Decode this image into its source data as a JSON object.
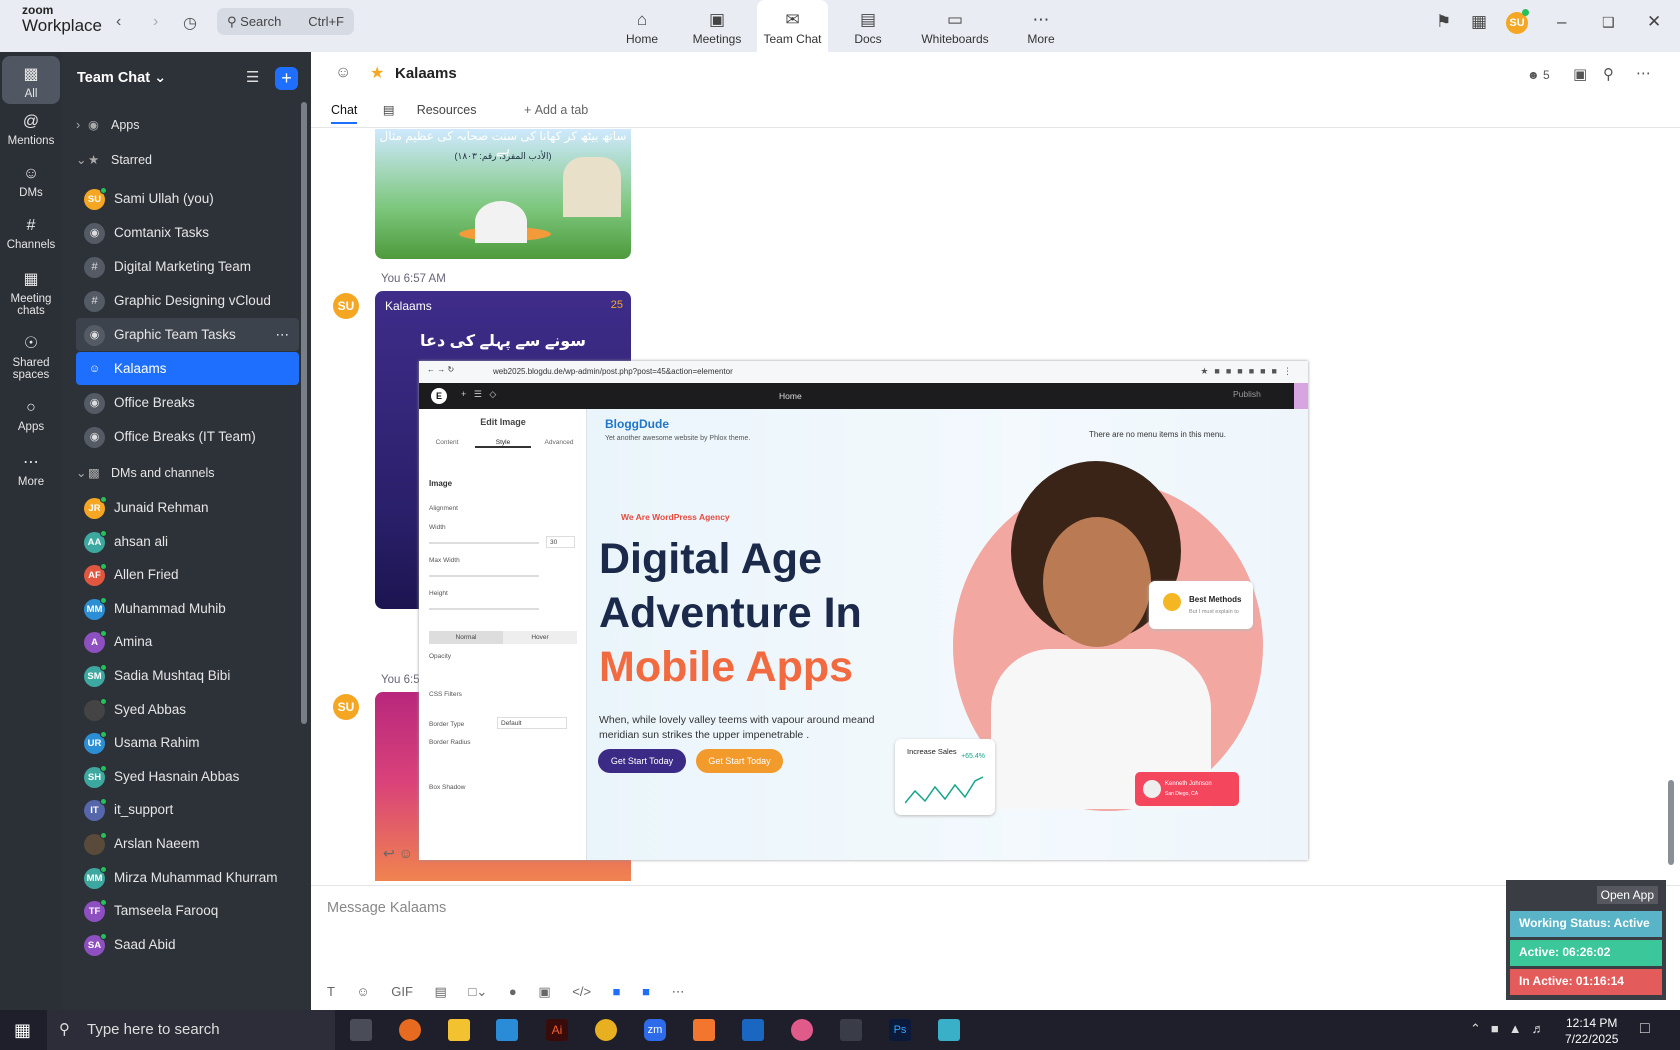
{
  "brand": {
    "line1": "zoom",
    "line2": "Workplace"
  },
  "search": {
    "label": "Search",
    "shortcut": "Ctrl+F"
  },
  "tabs": [
    {
      "label": "Home",
      "icon": "home-icon"
    },
    {
      "label": "Meetings",
      "icon": "video-icon"
    },
    {
      "label": "Team Chat",
      "icon": "chat-icon"
    },
    {
      "label": "Docs",
      "icon": "doc-icon"
    },
    {
      "label": "Whiteboards",
      "icon": "whiteboard-icon"
    },
    {
      "label": "More",
      "icon": "more-icon"
    }
  ],
  "user": {
    "initials": "SU"
  },
  "rail": [
    {
      "label": "All"
    },
    {
      "label": "Mentions"
    },
    {
      "label": "DMs"
    },
    {
      "label": "Channels"
    },
    {
      "label": "Meeting chats"
    },
    {
      "label": "Shared spaces"
    },
    {
      "label": "Apps"
    },
    {
      "label": "More"
    }
  ],
  "sidebar": {
    "title": "Team Chat",
    "apps": "Apps",
    "starred": "Starred",
    "dms": "DMs and channels",
    "starred_items": [
      {
        "label": "Sami Ullah (you)",
        "initials": "SU",
        "color": "#f5a623"
      },
      {
        "label": "Comtanix Tasks"
      },
      {
        "label": "Digital Marketing Team"
      },
      {
        "label": "Graphic Designing vCloud"
      },
      {
        "label": "Graphic Team Tasks"
      },
      {
        "label": "Kalaams"
      },
      {
        "label": "Office Breaks"
      },
      {
        "label": "Office Breaks (IT Team)"
      }
    ],
    "dm_items": [
      {
        "label": "Junaid Rehman",
        "initials": "JR",
        "color": "#f5a623"
      },
      {
        "label": "ahsan ali",
        "initials": "AA",
        "color": "#3ca8a0"
      },
      {
        "label": "Allen Fried",
        "initials": "AF",
        "color": "#e0563f"
      },
      {
        "label": "Muhammad Muhib",
        "initials": "MM",
        "color": "#2b8fd6"
      },
      {
        "label": "Amina",
        "initials": "A",
        "color": "#8e4fc0"
      },
      {
        "label": "Sadia Mushtaq Bibi",
        "initials": "SM",
        "color": "#3ca8a0"
      },
      {
        "label": "Syed Abbas",
        "initials": "",
        "color": "#444"
      },
      {
        "label": "Usama Rahim",
        "initials": "UR",
        "color": "#2b8fd6"
      },
      {
        "label": "Syed Hasnain Abbas",
        "initials": "SH",
        "color": "#3ca8a0"
      },
      {
        "label": "it_support",
        "initials": "IT",
        "color": "#5566aa"
      },
      {
        "label": "Arslan Naeem",
        "initials": "",
        "color": "#5a4a3a"
      },
      {
        "label": "Mirza Muhammad Khurram",
        "initials": "MM",
        "color": "#3ca8a0"
      },
      {
        "label": "Tamseela Farooq",
        "initials": "TF",
        "color": "#8e4fc0"
      },
      {
        "label": "Saad Abid",
        "initials": "SA",
        "color": "#8e4fc0"
      }
    ]
  },
  "channel": {
    "title": "Kalaams",
    "members": "5",
    "tabs": [
      "Chat",
      "Resources",
      "Add a tab"
    ]
  },
  "messages": [
    {
      "sender": "You 6:57 AM",
      "initials": "SU",
      "logo": "Kalaams",
      "badge": "25",
      "urdu": "سونے سے پہلے کی دعا"
    },
    {
      "sender": "You 6:5",
      "initials": "SU"
    }
  ],
  "image1": {
    "urdu": "ساتھ بیٹھ کر کھانا کی سنت صحابہ کی عظیم مثال ہے",
    "ref": "(الأدب المفرد، رقم: ۱۸۰۳)"
  },
  "screenshot": {
    "url": "web2025.blogdu.de/wp-admin/post.php?post=45&action=elementor",
    "home": "Home",
    "publish": "Publish",
    "panel_title": "Edit Image",
    "panel_tabs": [
      "Content",
      "Style",
      "Advanced"
    ],
    "section": "Image",
    "labels": [
      "Alignment",
      "Width",
      "Max Width",
      "Height",
      "Opacity",
      "CSS Filters",
      "Border Type",
      "Border Radius",
      "Box Shadow"
    ],
    "width_value": "30",
    "toggle": [
      "Normal",
      "Hover"
    ],
    "border_type": "Default",
    "site_title": "BloggDude",
    "tagline": "Yet another awesome website by Phlox theme.",
    "menu_note": "There are no menu items in this menu.",
    "agency": "We Are WordPress Agency",
    "hero": [
      "Digital Age",
      "Adventure In",
      "Mobile Apps"
    ],
    "desc": "When, while lovely valley teems with vapour around meand meridian sun strikes the upper impenetrable .",
    "btn1": "Get Start Today",
    "btn2": "Get Start Today",
    "card1": {
      "title": "Best Methods",
      "sub": "But I must explain to"
    },
    "card2": {
      "title": "Increase Sales",
      "pct": "+65.4%"
    },
    "card3": {
      "name": "Kenneth Johnson",
      "place": "San Diego, CA"
    }
  },
  "compose": {
    "placeholder": "Message Kalaams"
  },
  "status": {
    "open_app": "Open App",
    "working": "Working Status: Active",
    "active": "Active: 06:26:02",
    "inactive": "In Active: 01:16:14"
  },
  "taskbar": {
    "search": "Type here to search",
    "time": "12:14 PM",
    "date": "7/22/2025"
  },
  "colors": {
    "accent": "#1f6fff",
    "sidebar": "#2d3138",
    "rail": "#2b2f36",
    "active_green": "#3cc79a",
    "inactive_red": "#e35b5b",
    "status_teal": "#5ab4c8"
  }
}
